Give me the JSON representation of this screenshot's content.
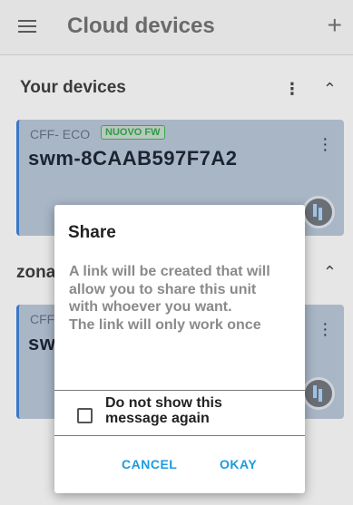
{
  "header": {
    "title": "Cloud devices"
  },
  "sections": [
    {
      "title": "Your devices"
    },
    {
      "title": "zona"
    }
  ],
  "cards": [
    {
      "model": "CFF- ECO",
      "badge": "NUOVO FW",
      "name": "swm-8CAAB597F7A2"
    },
    {
      "model": "CFF",
      "name": "sw"
    }
  ],
  "dialog": {
    "title": "Share",
    "message": [
      "A link will be created that will",
      "allow you to share this unit",
      "with whoever you want.",
      "The link will only work once"
    ],
    "checkbox_label_line1": "Do not show this",
    "checkbox_label_line2": "message again",
    "checkbox_checked": false,
    "cancel_label": "CANCEL",
    "okay_label": "OKAY"
  },
  "colors": {
    "accent": "#1a9be0",
    "card_bg": "#a9b6c6",
    "card_border": "#3b78c6",
    "badge": "#2e9b46"
  }
}
